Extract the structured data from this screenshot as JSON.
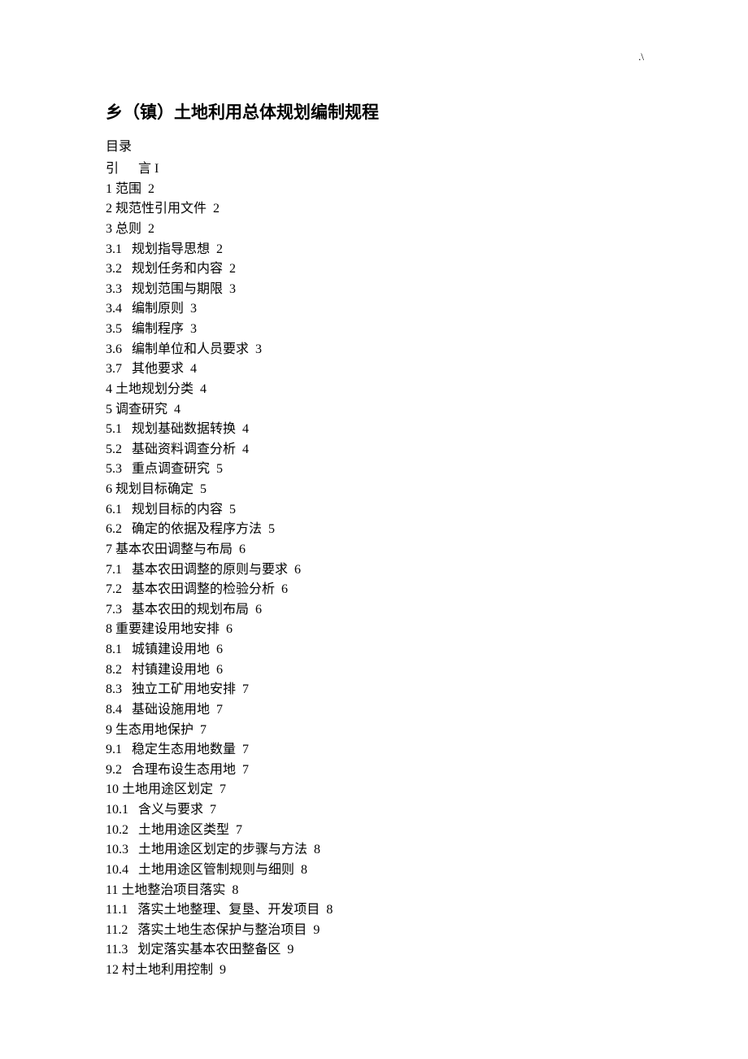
{
  "pageMark": ".\\",
  "title": "乡（镇）土地利用总体规划编制规程",
  "tocHeader": "目录",
  "toc": [
    {
      "label": "引      言 I",
      "indent": 0
    },
    {
      "label": "1 范围  2",
      "indent": 0
    },
    {
      "label": "2 规范性引用文件  2",
      "indent": 0
    },
    {
      "label": "3 总则  2",
      "indent": 0
    },
    {
      "label": "3.1   规划指导思想  2",
      "indent": 0
    },
    {
      "label": "3.2   规划任务和内容  2",
      "indent": 0
    },
    {
      "label": "3.3   规划范围与期限  3",
      "indent": 0
    },
    {
      "label": "3.4   编制原则  3",
      "indent": 0
    },
    {
      "label": "3.5   编制程序  3",
      "indent": 0
    },
    {
      "label": "3.6   编制单位和人员要求  3",
      "indent": 0
    },
    {
      "label": "3.7   其他要求  4",
      "indent": 0
    },
    {
      "label": "4 土地规划分类  4",
      "indent": 0
    },
    {
      "label": "5 调查研究  4",
      "indent": 0
    },
    {
      "label": "5.1   规划基础数据转换  4",
      "indent": 0
    },
    {
      "label": "5.2   基础资料调查分析  4",
      "indent": 0
    },
    {
      "label": "5.3   重点调查研究  5",
      "indent": 0
    },
    {
      "label": "6 规划目标确定  5",
      "indent": 0
    },
    {
      "label": "6.1   规划目标的内容  5",
      "indent": 0
    },
    {
      "label": "6.2   确定的依据及程序方法  5",
      "indent": 0
    },
    {
      "label": "7 基本农田调整与布局  6",
      "indent": 0
    },
    {
      "label": "7.1   基本农田调整的原则与要求  6",
      "indent": 0
    },
    {
      "label": "7.2   基本农田调整的检验分析  6",
      "indent": 0
    },
    {
      "label": "7.3   基本农田的规划布局  6",
      "indent": 0
    },
    {
      "label": "8 重要建设用地安排  6",
      "indent": 0
    },
    {
      "label": "8.1   城镇建设用地  6",
      "indent": 0
    },
    {
      "label": "8.2   村镇建设用地  6",
      "indent": 0
    },
    {
      "label": "8.3   独立工矿用地安排  7",
      "indent": 0
    },
    {
      "label": "8.4   基础设施用地  7",
      "indent": 0
    },
    {
      "label": "9 生态用地保护  7",
      "indent": 0
    },
    {
      "label": "9.1   稳定生态用地数量  7",
      "indent": 0
    },
    {
      "label": "9.2   合理布设生态用地  7",
      "indent": 0
    },
    {
      "label": "10 土地用途区划定  7",
      "indent": 0
    },
    {
      "label": "10.1   含义与要求  7",
      "indent": 0
    },
    {
      "label": "10.2   土地用途区类型  7",
      "indent": 0
    },
    {
      "label": "10.3   土地用途区划定的步骤与方法  8",
      "indent": 0
    },
    {
      "label": "10.4   土地用途区管制规则与细则  8",
      "indent": 0
    },
    {
      "label": "11 土地整治项目落实  8",
      "indent": 0
    },
    {
      "label": "11.1   落实土地整理、复垦、开发项目  8",
      "indent": 0
    },
    {
      "label": "11.2   落实土地生态保护与整治项目  9",
      "indent": 0
    },
    {
      "label": "11.3   划定落实基本农田整备区  9",
      "indent": 0
    },
    {
      "label": "12 村土地利用控制  9",
      "indent": 0
    }
  ]
}
